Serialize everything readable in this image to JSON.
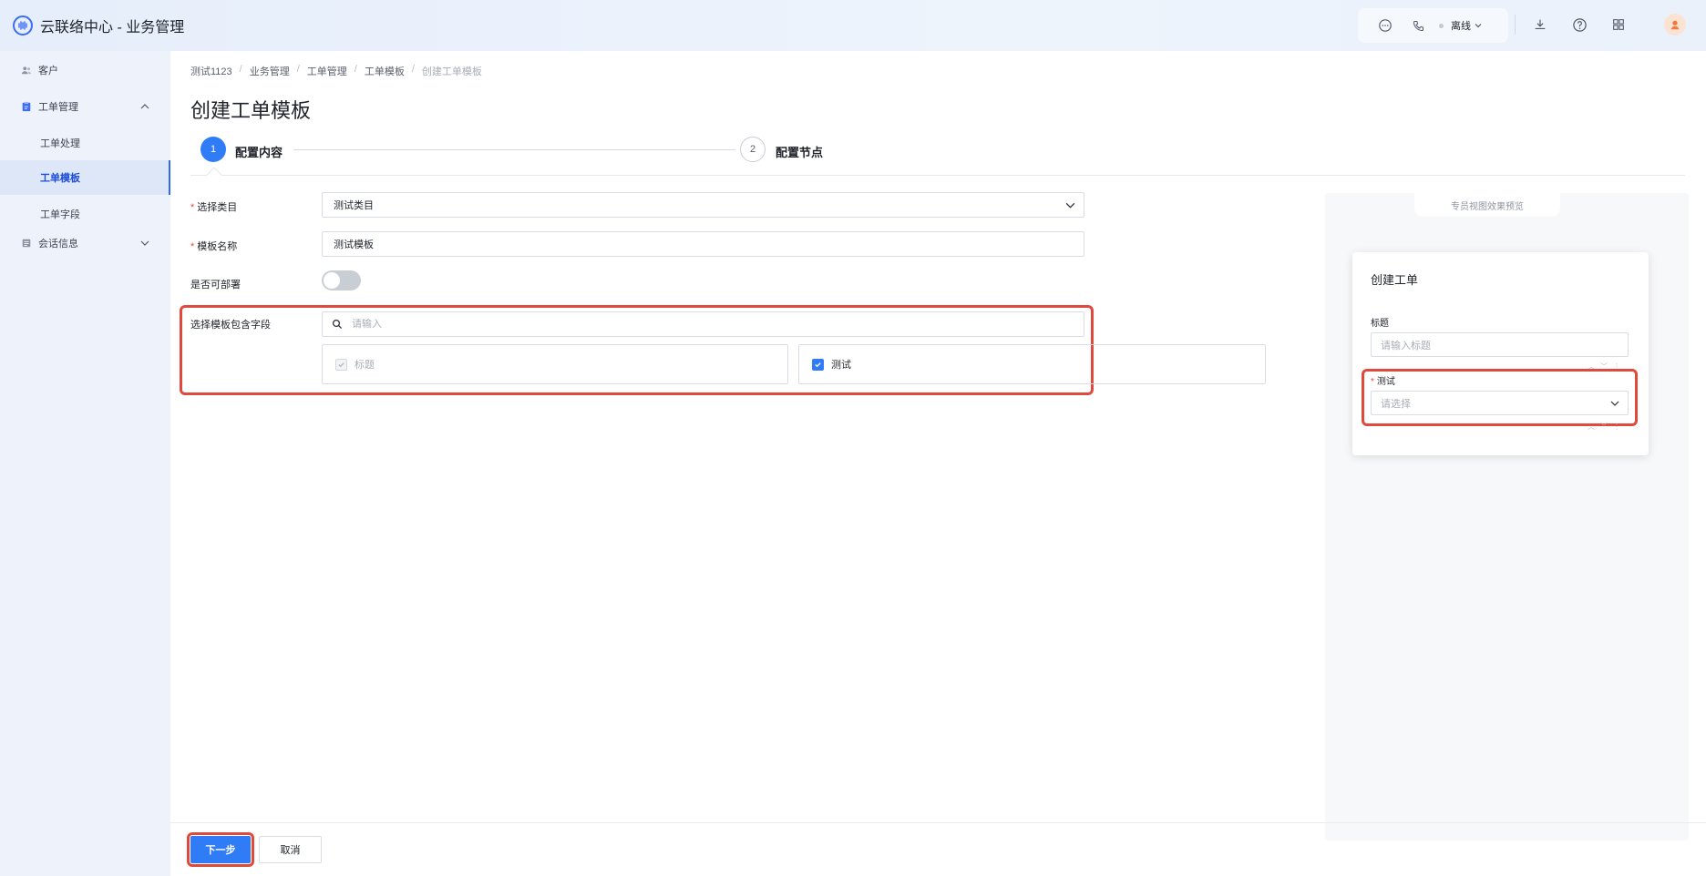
{
  "app": {
    "title": "云联络中心 - 业务管理"
  },
  "topbar": {
    "status_label": "离线",
    "icons": [
      "chat-icon",
      "phone-icon",
      "download-icon",
      "help-icon",
      "apps-icon"
    ]
  },
  "sidebar": {
    "items": [
      {
        "label": "客户",
        "icon": "users-icon"
      },
      {
        "label": "工单管理",
        "icon": "clipboard-icon",
        "expanded": true
      },
      {
        "label": "工单处理"
      },
      {
        "label": "工单模板",
        "active": true
      },
      {
        "label": "工单字段"
      },
      {
        "label": "会话信息",
        "icon": "chat-log-icon",
        "expanded": false
      }
    ]
  },
  "breadcrumb": [
    "测试1123",
    "业务管理",
    "工单管理",
    "工单模板",
    "创建工单模板"
  ],
  "page": {
    "title": "创建工单模板"
  },
  "steps": [
    {
      "number": "1",
      "label": "配置内容",
      "active": true
    },
    {
      "number": "2",
      "label": "配置节点",
      "active": false
    }
  ],
  "form": {
    "category": {
      "label": "选择类目",
      "value": "测试类目"
    },
    "template_name": {
      "label": "模板名称",
      "value": "测试模板"
    },
    "deployable": {
      "label": "是否可部署",
      "on": false
    },
    "fields": {
      "label": "选择模板包含字段",
      "search_placeholder": "请输入",
      "options": [
        {
          "label": "标题",
          "checked": true,
          "disabled": true
        },
        {
          "label": "测试",
          "checked": true,
          "disabled": false
        }
      ]
    }
  },
  "preview": {
    "tab_label": "专员视图效果预览",
    "card_title": "创建工单",
    "title_label": "标题",
    "title_placeholder": "请输入标题",
    "test_label": "测试",
    "test_placeholder": "请选择"
  },
  "footer": {
    "next_label": "下一步",
    "cancel_label": "取消"
  },
  "colors": {
    "primary": "#2f7cf6",
    "highlight": "#e04a3c",
    "required": "#e54545"
  }
}
